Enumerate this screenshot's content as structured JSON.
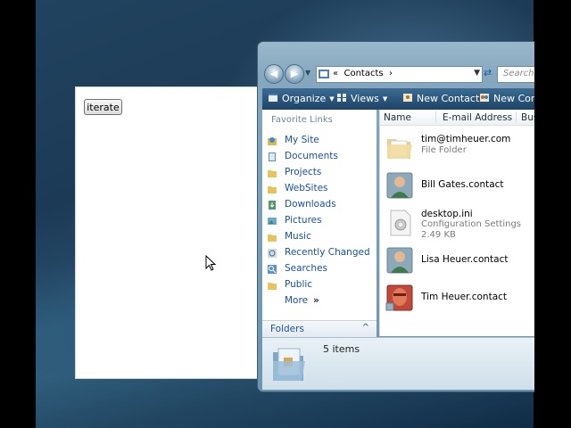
{
  "app": {
    "iterate_label": "iterate"
  },
  "explorer": {
    "address": {
      "chevrons": "«",
      "path": "Contacts",
      "arrow": "›"
    },
    "search_placeholder": "Search",
    "toolbar": {
      "organize": "Organize",
      "views": "Views",
      "new_contact": "New Contact",
      "new_contact_2": "New Conta"
    },
    "nav": {
      "favorite_links_title": "Favorite Links",
      "links": [
        {
          "label": "My Site",
          "icon": "site-icon"
        },
        {
          "label": "Documents",
          "icon": "documents-icon"
        },
        {
          "label": "Projects",
          "icon": "folder-icon"
        },
        {
          "label": "WebSites",
          "icon": "folder-icon"
        },
        {
          "label": "Downloads",
          "icon": "downloads-icon"
        },
        {
          "label": "Pictures",
          "icon": "pictures-icon"
        },
        {
          "label": "Music",
          "icon": "music-icon"
        },
        {
          "label": "Recently Changed",
          "icon": "recent-icon"
        },
        {
          "label": "Searches",
          "icon": "search-icon"
        },
        {
          "label": "Public",
          "icon": "folder-icon"
        }
      ],
      "more_label": "More",
      "more_chevron": "»",
      "folders_label": "Folders",
      "folders_chevron": "^"
    },
    "columns": {
      "name": "Name",
      "email": "E-mail Address",
      "business": "Bus"
    },
    "files": [
      {
        "name": "tim@timheuer.com",
        "sub1": "File Folder",
        "sub2": "",
        "icon": "folder-icon"
      },
      {
        "name": "Bill Gates.contact",
        "sub1": "",
        "sub2": "",
        "icon": "contact-icon"
      },
      {
        "name": "desktop.ini",
        "sub1": "Configuration Settings",
        "sub2": "2.49 KB",
        "icon": "settings-file-icon"
      },
      {
        "name": "Lisa Heuer.contact",
        "sub1": "",
        "sub2": "",
        "icon": "contact-icon"
      },
      {
        "name": "Tim Heuer.contact",
        "sub1": "",
        "sub2": "",
        "icon": "contact-photo-icon"
      }
    ],
    "details": {
      "count": "5 items"
    }
  }
}
